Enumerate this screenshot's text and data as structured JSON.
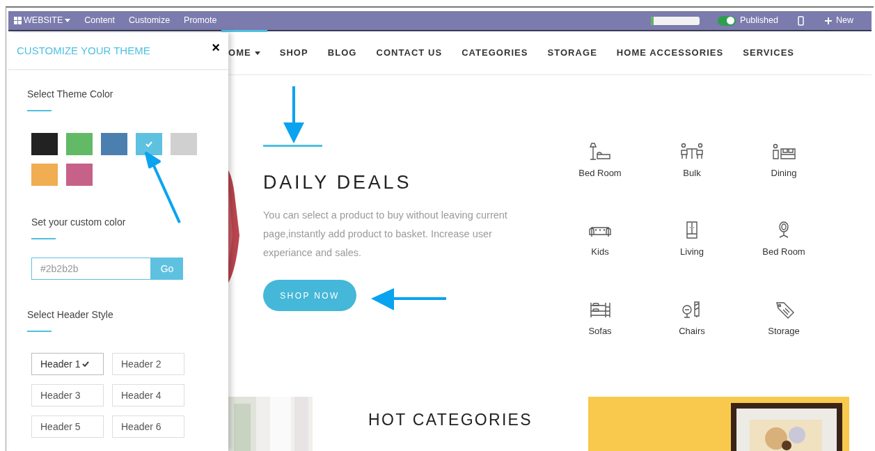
{
  "admin_bar": {
    "app_menu": "WEBSITE",
    "menu": [
      "Content",
      "Customize",
      "Promote"
    ],
    "progress": {
      "level": 0.05
    },
    "published": {
      "label": "Published",
      "on": true
    },
    "new_button": "New"
  },
  "nav": {
    "items": [
      {
        "label": "OME",
        "selected": true,
        "dropdown": true
      },
      {
        "label": "SHOP",
        "selected": false,
        "dropdown": false
      },
      {
        "label": "BLOG",
        "selected": false,
        "dropdown": false
      },
      {
        "label": "CONTACT US",
        "selected": false,
        "dropdown": false
      },
      {
        "label": "CATEGORIES",
        "selected": false,
        "dropdown": false
      },
      {
        "label": "STORAGE",
        "selected": false,
        "dropdown": false
      },
      {
        "label": "HOME ACCESSORIES",
        "selected": false,
        "dropdown": false
      },
      {
        "label": "SERVICES",
        "selected": false,
        "dropdown": false
      }
    ]
  },
  "hero": {
    "title": "DAILY DEALS",
    "text": "You can select a product to buy without leaving current page,instantly add product to basket. Increase user experiance and sales.",
    "button": "SHOP NOW"
  },
  "categories": [
    {
      "label": "Bed Room"
    },
    {
      "label": "Bulk"
    },
    {
      "label": "Dining"
    },
    {
      "label": "Kids"
    },
    {
      "label": "Living"
    },
    {
      "label": "Bed Room"
    },
    {
      "label": "Sofas"
    },
    {
      "label": "Chairs"
    },
    {
      "label": "Storage"
    }
  ],
  "hot_categories": {
    "title": "HOT CATEGORIES"
  },
  "customize_panel": {
    "title": "CUSTOMIZE YOUR THEME",
    "close": "×",
    "theme_color": {
      "label": "Select Theme Color",
      "swatches": [
        {
          "color": "#222222",
          "selected": false
        },
        {
          "color": "#62b966",
          "selected": false
        },
        {
          "color": "#4b7fb0",
          "selected": false
        },
        {
          "color": "#5fc1e0",
          "selected": true
        },
        {
          "color": "#d0d0d0",
          "selected": false
        },
        {
          "color": "#f0ad52",
          "selected": false
        },
        {
          "color": "#c6628a",
          "selected": false
        }
      ]
    },
    "custom_color": {
      "label": "Set your custom color",
      "placeholder": "#2b2b2b",
      "button": "Go"
    },
    "header_style": {
      "label": "Select Header Style",
      "options": [
        {
          "label": "Header 1",
          "selected": true
        },
        {
          "label": "Header 2",
          "selected": false
        },
        {
          "label": "Header 3",
          "selected": false
        },
        {
          "label": "Header 4",
          "selected": false
        },
        {
          "label": "Header 5",
          "selected": false
        },
        {
          "label": "Header 6",
          "selected": false
        }
      ]
    }
  }
}
